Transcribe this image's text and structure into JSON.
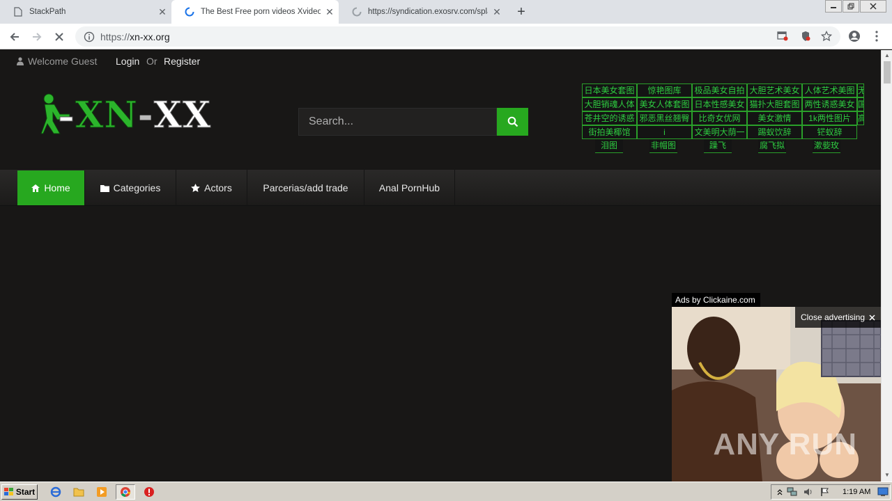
{
  "browser": {
    "tabs": [
      {
        "title": "StackPath",
        "state": "idle"
      },
      {
        "title": "The Best Free porn videos Xvideos",
        "state": "loading"
      },
      {
        "title": "https://syndication.exosrv.com/spla",
        "state": "loading"
      }
    ],
    "new_tab_label": "+",
    "url_scheme": "https://",
    "url_host": "xn-xx.org"
  },
  "site": {
    "topbar": {
      "welcome": "Welcome Guest",
      "login": "Login",
      "or": "Or",
      "register": "Register"
    },
    "logo": {
      "part1": "XN",
      "dash": "-",
      "part2": "XX"
    },
    "search": {
      "placeholder": "Search..."
    },
    "link_grid": [
      [
        "日本美女套图",
        "惊艳图库",
        "极品美女自拍",
        "大胆艺术美女",
        "人体艺术美图",
        "无"
      ],
      [
        "大胆销魂人体",
        "美女人体套图",
        "日本性感美女",
        "猫扑大胆套图",
        "两性诱惑美女",
        "国"
      ],
      [
        "苍井空的诱惑",
        "邪恶黑丝翘臀",
        "比奇女优网",
        "美女激情",
        "1k两性图片",
        "高"
      ],
      [
        "街拍美椰馆",
        "i",
        "文美明大荫一",
        "踢蚁饮辞",
        "铓蚁辞",
        ""
      ],
      [
        "泪图",
        "非帽图",
        "躁飞",
        "腐飞拟",
        "漱姕玫",
        ""
      ]
    ],
    "nav": [
      {
        "label": "Home",
        "icon": "home-icon",
        "active": true
      },
      {
        "label": "Categories",
        "icon": "folder-icon",
        "active": false
      },
      {
        "label": "Actors",
        "icon": "star-icon",
        "active": false
      },
      {
        "label": "Parcerias/add trade",
        "icon": "",
        "active": false
      },
      {
        "label": "Anal PornHub",
        "icon": "",
        "active": false
      }
    ],
    "ad": {
      "provider_label": "Ads by Clickaine.com",
      "close_label": "Close advertising",
      "watermark": "ANY RUN"
    }
  },
  "taskbar": {
    "start_label": "Start",
    "clock": "1:19 AM"
  },
  "colors": {
    "accent_green": "#27a81f",
    "page_bg": "#181716",
    "link_green": "#2ecc40"
  }
}
